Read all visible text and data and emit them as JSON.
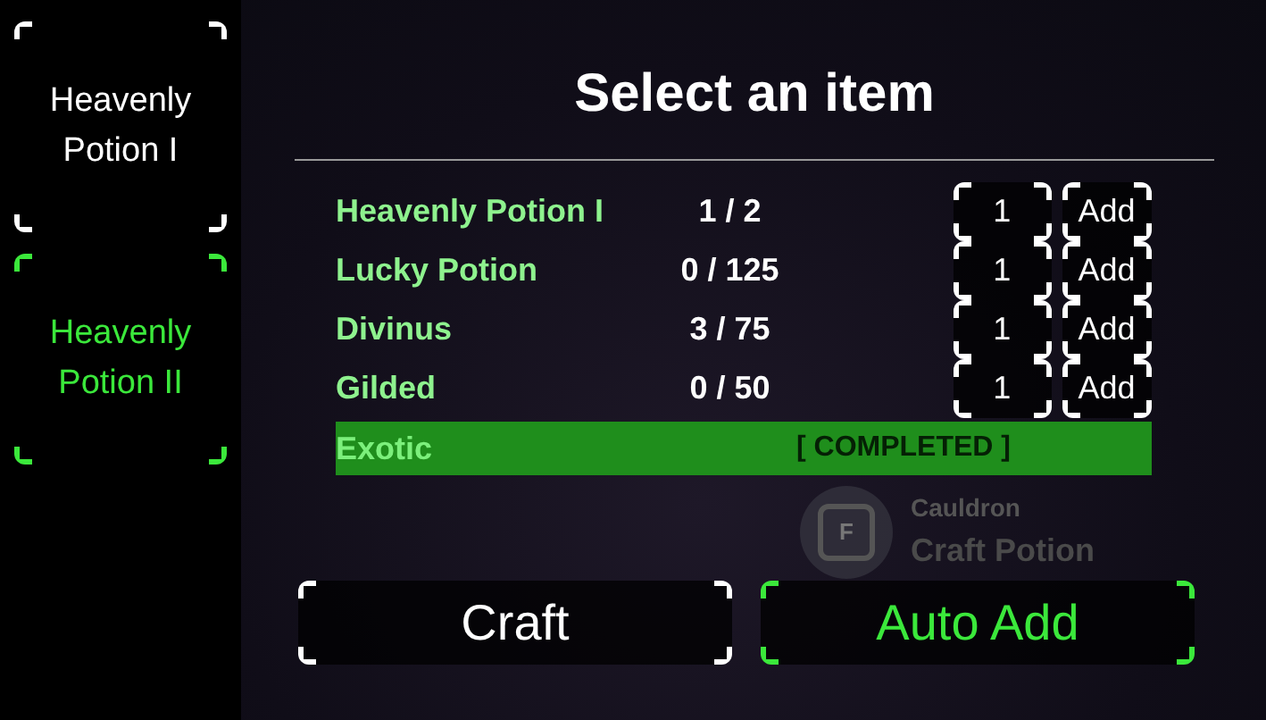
{
  "sidebar": {
    "items": [
      {
        "label": "Heavenly Potion I",
        "selected": false
      },
      {
        "label": "Heavenly Potion II",
        "selected": true
      }
    ]
  },
  "panel": {
    "title": "Select an item",
    "rows": [
      {
        "kind": "pending",
        "name": "Heavenly Potion I",
        "count": "1 / 2",
        "quantity": "1",
        "action": "Add"
      },
      {
        "kind": "pending",
        "name": "Lucky Potion",
        "count": "0 / 125",
        "quantity": "1",
        "action": "Add"
      },
      {
        "kind": "pending",
        "name": "Divinus",
        "count": "3 / 75",
        "quantity": "1",
        "action": "Add"
      },
      {
        "kind": "pending",
        "name": "Gilded",
        "count": "0 / 50",
        "quantity": "1",
        "action": "Add"
      },
      {
        "kind": "completed",
        "name": "Exotic",
        "status": "[ COMPLETED ]"
      }
    ],
    "buttons": [
      {
        "label": "Craft",
        "kind": "plain"
      },
      {
        "label": "Auto Add",
        "kind": "accent"
      }
    ]
  },
  "prompt": {
    "key": "F",
    "object": "Cauldron",
    "action": "Craft Potion"
  }
}
